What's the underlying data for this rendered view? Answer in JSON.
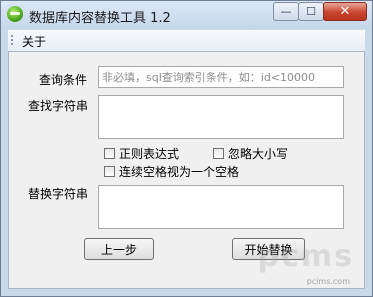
{
  "window": {
    "title": "数据库内容替换工具 1.2",
    "minimize_glyph": "—",
    "maximize_glyph": "☐",
    "close_glyph": "✕"
  },
  "menu": {
    "items": [
      {
        "label": "关于"
      }
    ]
  },
  "form": {
    "query_label": "查询条件",
    "query_placeholder": "非必填，sql查询索引条件，如：id<10000",
    "find_label": "查找字符串",
    "replace_label": "替换字符串",
    "options": [
      {
        "label": "正则表达式",
        "checked": false
      },
      {
        "label": "忽略大小写",
        "checked": false
      },
      {
        "label": "连续空格视为一个空格",
        "checked": false
      }
    ]
  },
  "buttons": {
    "back": "上一步",
    "start": "开始替换"
  },
  "watermark": {
    "text": "pcms",
    "small": "pcims.com"
  }
}
